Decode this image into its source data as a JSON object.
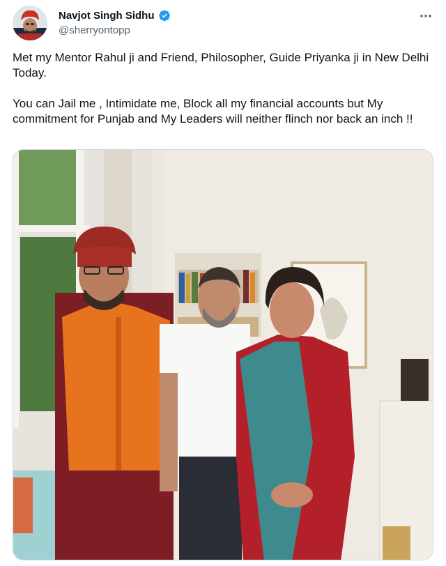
{
  "author": {
    "display_name": "Navjot Singh Sidhu",
    "handle": "@sherryontopp",
    "verified_icon": "verified-badge-icon",
    "avatar_icon": "avatar"
  },
  "tweet": {
    "paragraph_1": "Met my Mentor Rahul ji and Friend, Philosopher, Guide Priyanka ji in New Delhi Today.",
    "paragraph_2": "You can Jail me , Intimidate me, Block all my financial accounts but My commitment for Punjab and My Leaders will neither flinch nor back an inch !!"
  },
  "menu": {
    "more_icon": "more-options-icon"
  },
  "colors": {
    "text": "#0f1419",
    "secondary": "#536471",
    "verified": "#1d9bf0",
    "border": "#cfd9de"
  }
}
